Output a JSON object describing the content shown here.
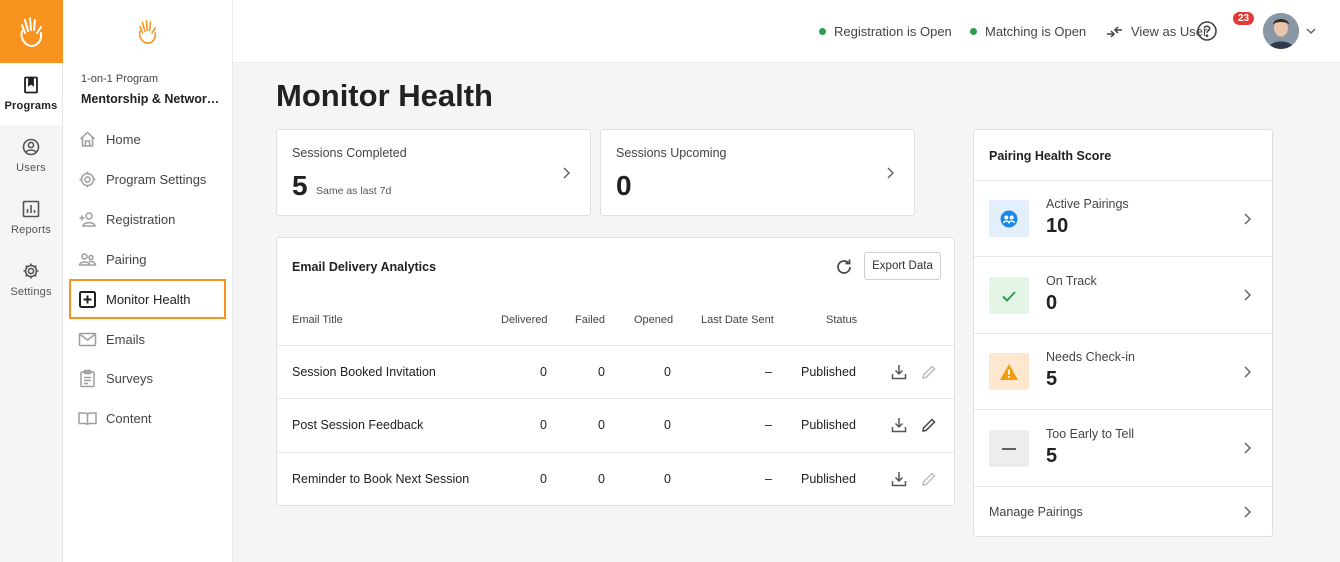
{
  "rail": {
    "items": [
      {
        "label": "Programs",
        "icon": "book-icon"
      },
      {
        "label": "Users",
        "icon": "user-icon"
      },
      {
        "label": "Reports",
        "icon": "report-icon"
      },
      {
        "label": "Settings",
        "icon": "gear-icon"
      }
    ]
  },
  "program": {
    "type": "1-on-1 Program",
    "name": "Mentorship & Networking"
  },
  "menu": {
    "items": [
      {
        "label": "Home",
        "icon": "home-icon"
      },
      {
        "label": "Program Settings",
        "icon": "gear-icon"
      },
      {
        "label": "Registration",
        "icon": "add-person-icon"
      },
      {
        "label": "Pairing",
        "icon": "people-icon"
      },
      {
        "label": "Monitor Health",
        "icon": "plus-box-icon"
      },
      {
        "label": "Emails",
        "icon": "mail-icon"
      },
      {
        "label": "Surveys",
        "icon": "clipboard-icon"
      },
      {
        "label": "Content",
        "icon": "open-book-icon"
      }
    ]
  },
  "topbar": {
    "registration": "Registration is Open",
    "matching": "Matching is Open",
    "view_as_user": "View as User",
    "notifications": "23"
  },
  "page": {
    "title": "Monitor Health"
  },
  "sessions_completed": {
    "label": "Sessions Completed",
    "value": "5",
    "sub": "Same as last 7d"
  },
  "sessions_upcoming": {
    "label": "Sessions Upcoming",
    "value": "0"
  },
  "email": {
    "title": "Email Delivery Analytics",
    "export_label": "Export Data",
    "columns": [
      "Email Title",
      "Delivered",
      "Failed",
      "Opened",
      "Last Date Sent",
      "Status"
    ],
    "rows": [
      {
        "title": "Session Booked Invitation",
        "delivered": "0",
        "failed": "0",
        "opened": "0",
        "last_sent": "–",
        "status": "Published"
      },
      {
        "title": "Post Session Feedback",
        "delivered": "0",
        "failed": "0",
        "opened": "0",
        "last_sent": "–",
        "status": "Published"
      },
      {
        "title": "Reminder to Book Next Session",
        "delivered": "0",
        "failed": "0",
        "opened": "0",
        "last_sent": "–",
        "status": "Published"
      }
    ]
  },
  "pairing": {
    "title": "Pairing Health Score",
    "rows": [
      {
        "label": "Active Pairings",
        "value": "10"
      },
      {
        "label": "On Track",
        "value": "0"
      },
      {
        "label": "Needs Check-in",
        "value": "5"
      },
      {
        "label": "Too Early to Tell",
        "value": "5"
      }
    ],
    "manage": "Manage Pairings"
  },
  "colors": {
    "brand": "#f7931e",
    "success": "#2e9e48",
    "badge": "#e53935",
    "active_blue": "#1e88e5",
    "warning": "#f39c12"
  }
}
